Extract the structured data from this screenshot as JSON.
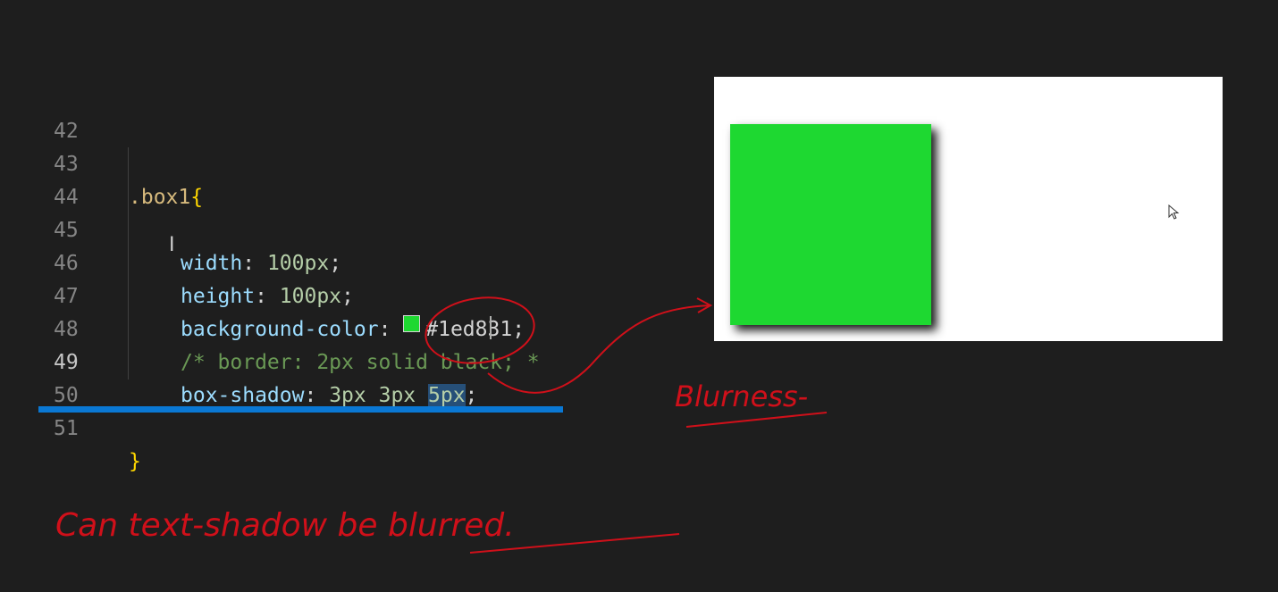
{
  "editor": {
    "lines": [
      {
        "number": "42"
      },
      {
        "number": "43",
        "selector": ".box1",
        "brace": "{"
      },
      {
        "number": "44"
      },
      {
        "number": "45",
        "prop": "width",
        "colon": ": ",
        "value": "100px",
        "semi": ";"
      },
      {
        "number": "46",
        "prop": "height",
        "colon": ": ",
        "value": "100px",
        "semi": ";"
      },
      {
        "number": "47",
        "prop": "background-color",
        "colon": ": ",
        "value": "#1ed831",
        "semi": ";"
      },
      {
        "number": "48",
        "comment": "/* border: 2px solid black; *"
      },
      {
        "number": "49",
        "prop": "box-shadow",
        "colon": ": ",
        "value1": "3px",
        "value2": "3px",
        "value3": "5px",
        "semi": ";"
      },
      {
        "number": "50"
      },
      {
        "number": "51",
        "brace": "}"
      }
    ],
    "active_line": "49"
  },
  "preview": {
    "box_color": "#1ed831",
    "shadow": "box-shadow"
  },
  "annotations": {
    "side_note": "Blurness-",
    "question": "Can text-shadow be blurred."
  },
  "colors": {
    "background": "#1e1e1e",
    "accent_bar": "#0a78d4",
    "ink": "#d0101a",
    "swatch": "#1ed831"
  }
}
